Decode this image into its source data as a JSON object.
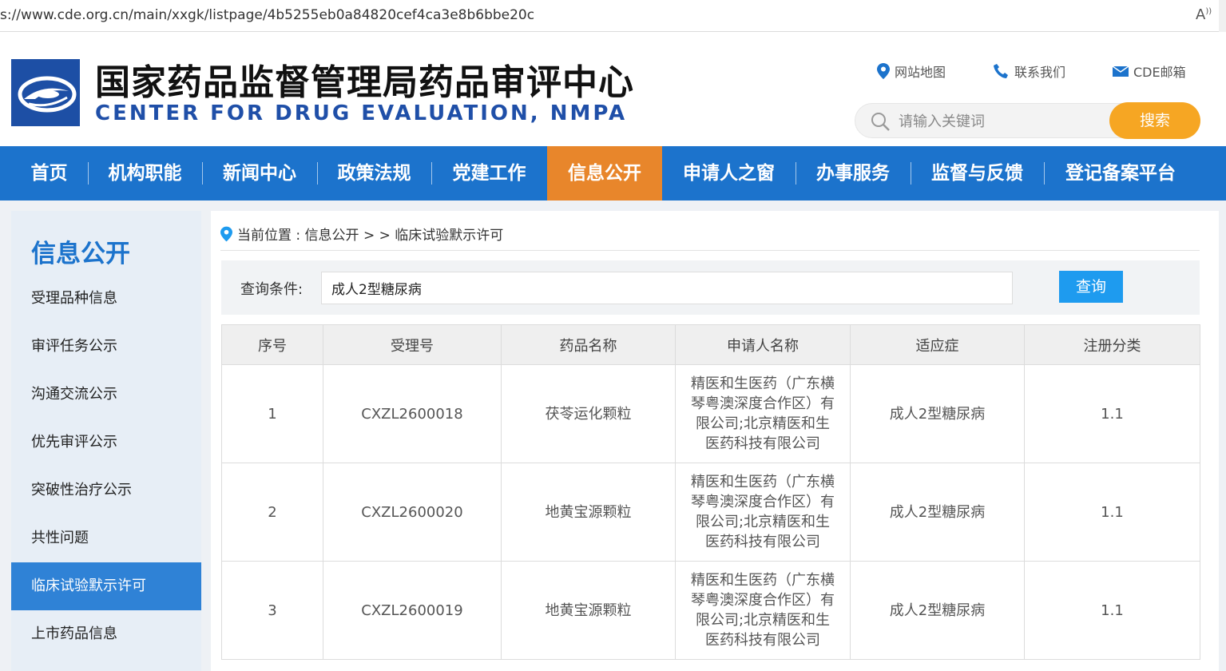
{
  "browser": {
    "url": "s://www.cde.org.cn/main/xxgk/listpage/4b5255eb0a84820cef4ca3e8b6bbe20c",
    "reader_icon": "read-aloud-icon"
  },
  "header": {
    "title_cn": "国家药品监督管理局药品审评中心",
    "title_en": "CENTER FOR DRUG EVALUATION, NMPA",
    "links": {
      "sitemap": "网站地图",
      "contact": "联系我们",
      "mail": "CDE邮箱"
    },
    "search": {
      "placeholder": "请输入关键词",
      "button": "搜索"
    }
  },
  "nav": {
    "items": [
      "首页",
      "机构职能",
      "新闻中心",
      "政策法规",
      "党建工作",
      "信息公开",
      "申请人之窗",
      "办事服务",
      "监督与反馈",
      "登记备案平台"
    ],
    "active": "信息公开"
  },
  "sidebar": {
    "title": "信息公开",
    "items": [
      "受理品种信息",
      "审评任务公示",
      "沟通交流公示",
      "优先审评公示",
      "突破性治疗公示",
      "共性问题",
      "临床试验默示许可",
      "上市药品信息"
    ],
    "active": "临床试验默示许可"
  },
  "breadcrumb": {
    "text": "当前位置 : 信息公开  > >  临床试验默示许可"
  },
  "query": {
    "label": "查询条件:",
    "value": "成人2型糖尿病",
    "button": "查询"
  },
  "table": {
    "headers": [
      "序号",
      "受理号",
      "药品名称",
      "申请人名称",
      "适应症",
      "注册分类"
    ],
    "rows": [
      [
        "1",
        "CXZL2600018",
        "茯苓运化颗粒",
        "精医和生医药（广东横琴粤澳深度合作区）有限公司;北京精医和生医药科技有限公司",
        "成人2型糖尿病",
        "1.1"
      ],
      [
        "2",
        "CXZL2600020",
        "地黄宝源颗粒",
        "精医和生医药（广东横琴粤澳深度合作区）有限公司;北京精医和生医药科技有限公司",
        "成人2型糖尿病",
        "1.1"
      ],
      [
        "3",
        "CXZL2600019",
        "地黄宝源颗粒",
        "精医和生医药（广东横琴粤澳深度合作区）有限公司;北京精医和生医药科技有限公司",
        "成人2型糖尿病",
        "1.1"
      ]
    ]
  },
  "colors": {
    "nav_bg": "#1c73cc",
    "nav_active": "#e8862b",
    "search_button": "#f6a623",
    "query_button": "#1e9bef",
    "sidebar_active": "#2f82d6"
  }
}
